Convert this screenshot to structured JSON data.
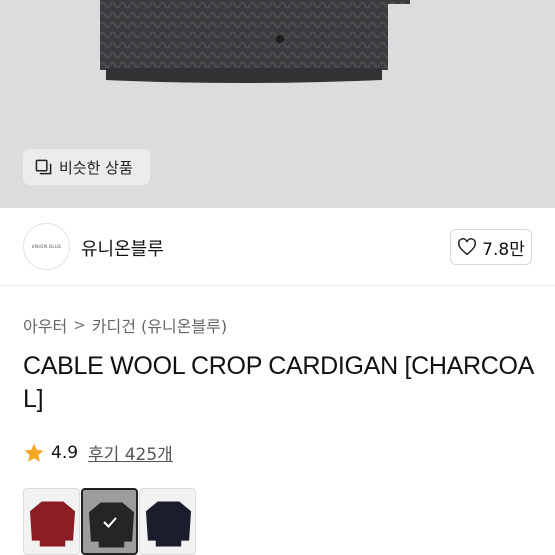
{
  "hero": {
    "similar_label": "비슷한 상품",
    "similar_icon": "similar-items-icon"
  },
  "brand": {
    "logo_text": "UNION BLUE",
    "name": "유니온블루",
    "likes": "7.8만",
    "like_icon": "heart-icon"
  },
  "breadcrumb": {
    "items": [
      "아우터",
      "카디건 (유니온블루)"
    ],
    "separator": ">"
  },
  "product": {
    "title": "CABLE WOOL CROP CARDIGAN [CHARCOAL]"
  },
  "rating": {
    "icon": "star-icon",
    "star_color": "#f5a623",
    "score": "4.9",
    "reviews": "후기 425개"
  },
  "swatches": [
    {
      "color": "#8a1e24",
      "selected": false
    },
    {
      "color": "#3a3a3a",
      "selected": true
    },
    {
      "color": "#1a1e2c",
      "selected": false
    }
  ]
}
